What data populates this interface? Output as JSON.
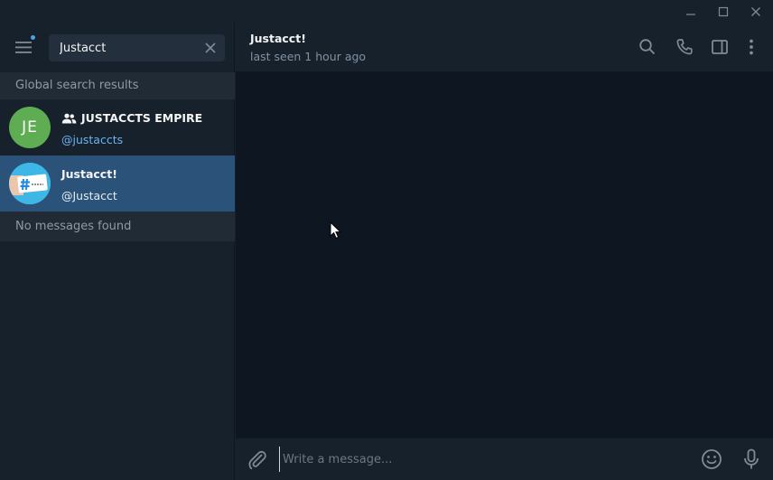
{
  "window": {
    "controls": [
      "minimize-icon",
      "maximize-icon",
      "close-icon"
    ]
  },
  "sidebar": {
    "search": {
      "value": "Justacct"
    },
    "global_header": "Global search results",
    "results": [
      {
        "initials": "JE",
        "title": "JUSTACCTS EMPIRE",
        "subtitle": "@justaccts",
        "avatar_color": "#5ead53",
        "is_group": true
      },
      {
        "title": "Justacct!",
        "subtitle": "@Justacct",
        "active": true
      }
    ],
    "no_messages": "No messages found"
  },
  "chat": {
    "title": "Justacct!",
    "status": "last seen 1 hour ago",
    "header_icons": [
      "search-icon",
      "phone-icon",
      "sidebar-toggle-icon",
      "more-icon"
    ]
  },
  "composer": {
    "placeholder": "Write a message..."
  },
  "colors": {
    "accent": "#2b5278",
    "link": "#6ab3f3",
    "background": "#0e1621",
    "panel": "#17212b"
  }
}
